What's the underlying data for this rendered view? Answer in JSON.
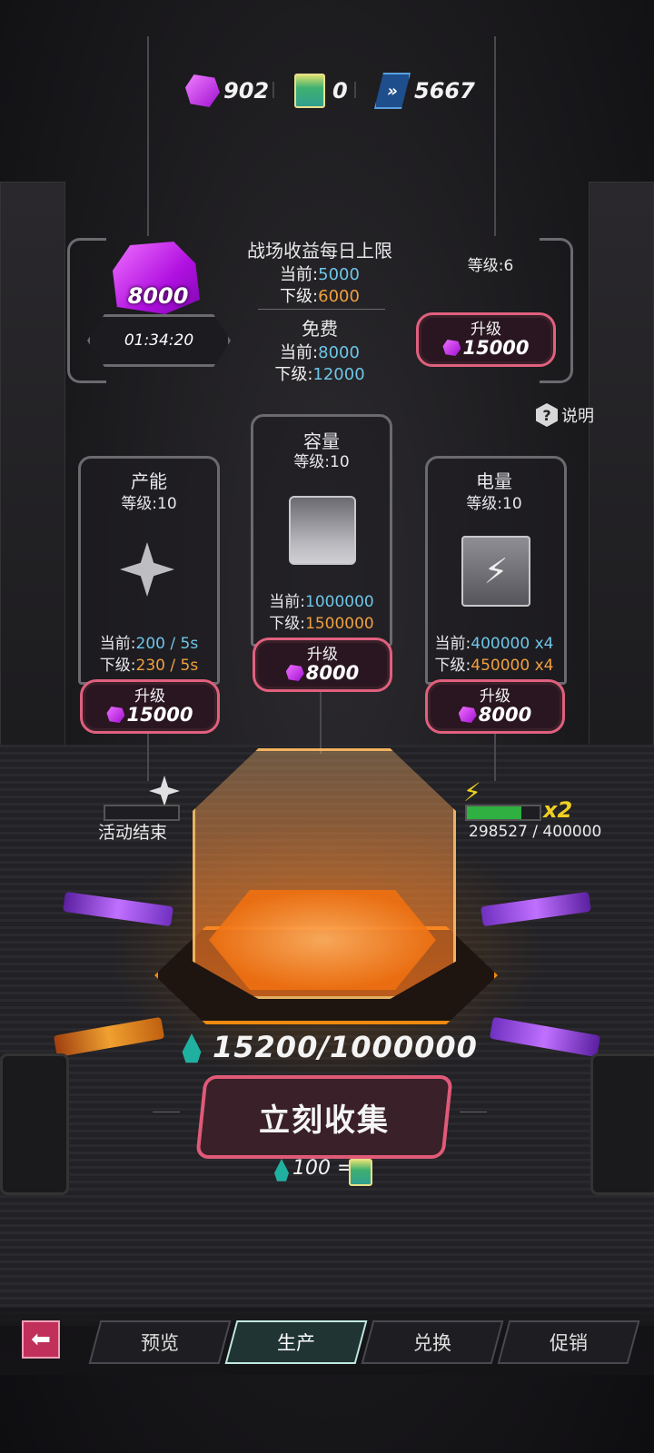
{
  "currency": {
    "gems": "902",
    "tickets": "0",
    "chips": "5667"
  },
  "daily_limit": {
    "title": "战场收益每日上限",
    "current_label": "当前:",
    "current_value": "5000",
    "next_label": "下级:",
    "next_value": "6000",
    "free_title": "免费",
    "free_current_value": "8000",
    "free_next_value": "12000",
    "stored_amount": "8000",
    "timer": "01:34:20",
    "level": "等级:6",
    "upgrade_label": "升级",
    "upgrade_cost": "15000"
  },
  "help": {
    "label": "说明"
  },
  "production": {
    "title": "产能",
    "level": "等级:10",
    "current_label": "当前:",
    "current_value": "200 / 5s",
    "next_label": "下级:",
    "next_value": "230 / 5s",
    "upgrade_label": "升级",
    "upgrade_cost": "15000",
    "status": "活动结束"
  },
  "capacity": {
    "title": "容量",
    "level": "等级:10",
    "current_label": "当前:",
    "current_value": "1000000",
    "next_label": "下级:",
    "next_value": "1500000",
    "upgrade_label": "升级",
    "upgrade_cost": "8000"
  },
  "power": {
    "title": "电量",
    "level": "等级:10",
    "current_label": "当前:",
    "current_value": "400000 x4",
    "next_label": "下级:",
    "next_value": "450000 x4",
    "upgrade_label": "升级",
    "upgrade_cost": "8000",
    "multiplier": "x2",
    "progress_text": "298527 / 400000",
    "progress_fraction": 0.746
  },
  "collector": {
    "amount": "15200/1000000",
    "collect_label": "立刻收集",
    "rate_text": "100 ="
  },
  "tabs": [
    {
      "label": "预览",
      "active": false
    },
    {
      "label": "生产",
      "active": true
    },
    {
      "label": "兑换",
      "active": false
    },
    {
      "label": "促销",
      "active": false
    }
  ],
  "colors": {
    "accent_pink": "#e0607e",
    "value_blue": "#6ec6e8",
    "value_orange": "#f0a040",
    "gem_purple": "#c020e0",
    "power_green": "#2fb040"
  }
}
